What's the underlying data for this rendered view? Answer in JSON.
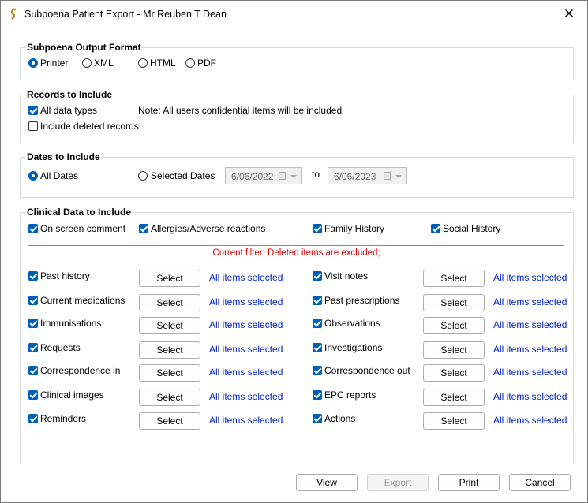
{
  "window": {
    "title": "Subpoena Patient Export - Mr Reuben T Dean",
    "close": "✕"
  },
  "output_format": {
    "title": "Subpoena Output Format",
    "options": [
      "Printer",
      "XML",
      "HTML",
      "PDF"
    ],
    "selected": "Printer"
  },
  "records": {
    "title": "Records to Include",
    "all_data_types": "All data types",
    "all_data_types_checked": true,
    "note": "Note: All users confidential items will be included",
    "include_deleted": "Include deleted records",
    "include_deleted_checked": false
  },
  "dates": {
    "title": "Dates to Include",
    "all_dates": "All Dates",
    "selected_dates": "Selected Dates",
    "selected": "All Dates",
    "from": "6/06/2022",
    "to_label": "to",
    "to": "6/06/2023"
  },
  "clinical": {
    "title": "Clinical Data to Include",
    "top": [
      {
        "label": "On screen comment",
        "checked": true
      },
      {
        "label": "Allergies/Adverse reactions",
        "checked": true
      },
      {
        "label": "Family History",
        "checked": true
      },
      {
        "label": "Social History",
        "checked": true
      }
    ],
    "filter": "Current filter: Deleted items are excluded;",
    "select_label": "Select",
    "status_text": "All items selected",
    "left": [
      {
        "label": "Past history",
        "checked": true
      },
      {
        "label": "Current medications",
        "checked": true
      },
      {
        "label": "Immunisations",
        "checked": true
      },
      {
        "label": "Requests",
        "checked": true
      },
      {
        "label": "Correspondence in",
        "checked": true
      },
      {
        "label": "Clinical images",
        "checked": true
      },
      {
        "label": "Reminders",
        "checked": true
      }
    ],
    "right": [
      {
        "label": "Visit notes",
        "checked": true
      },
      {
        "label": "Past prescriptions",
        "checked": true
      },
      {
        "label": "Observations",
        "checked": true
      },
      {
        "label": "Investigations",
        "checked": true
      },
      {
        "label": "Correspondence out",
        "checked": true
      },
      {
        "label": "EPC reports",
        "checked": true
      },
      {
        "label": "Actions",
        "checked": true
      }
    ]
  },
  "buttons": {
    "view": "View",
    "export": "Export",
    "print": "Print",
    "cancel": "Cancel"
  }
}
